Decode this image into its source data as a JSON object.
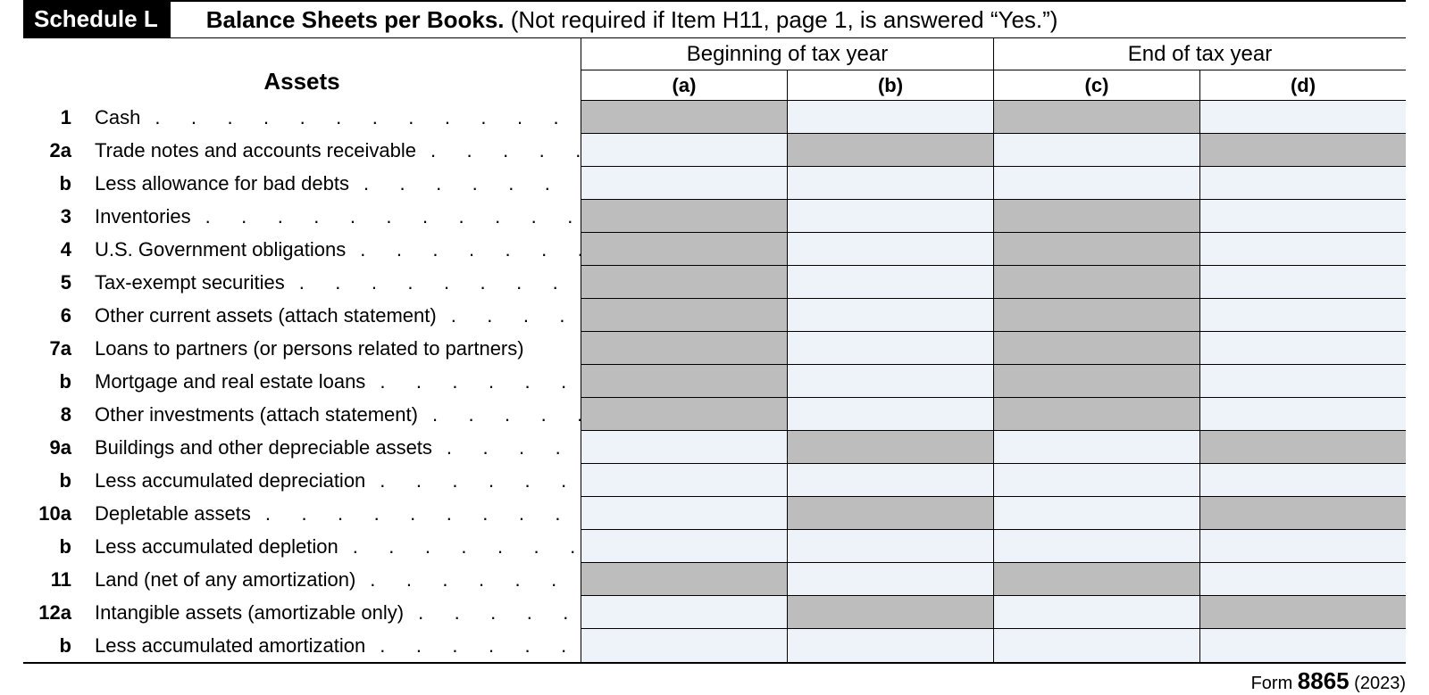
{
  "schedule": {
    "badge": "Schedule L",
    "title_bold": "Balance Sheets per Books.",
    "title_rest": " (Not required if Item H11, page 1, is answered “Yes.”)"
  },
  "headers": {
    "assets": "Assets",
    "period_begin": "Beginning of tax year",
    "period_end": "End of tax year",
    "col_a": "(a)",
    "col_b": "(b)",
    "col_c": "(c)",
    "col_d": "(d)"
  },
  "rows": [
    {
      "num": "1",
      "label": "Cash",
      "shaded": [
        "a",
        "c"
      ]
    },
    {
      "num": "2a",
      "label": "Trade notes and accounts receivable",
      "shaded": [
        "b",
        "d"
      ]
    },
    {
      "num": "b",
      "label": "Less allowance for bad debts",
      "shaded": []
    },
    {
      "num": "3",
      "label": "Inventories",
      "shaded": [
        "a",
        "c"
      ]
    },
    {
      "num": "4",
      "label": "U.S. Government obligations",
      "shaded": [
        "a",
        "c"
      ]
    },
    {
      "num": "5",
      "label": "Tax-exempt securities",
      "shaded": [
        "a",
        "c"
      ]
    },
    {
      "num": "6",
      "label": "Other current assets (attach statement)",
      "shaded": [
        "a",
        "c"
      ]
    },
    {
      "num": "7a",
      "label": "Loans to partners (or persons related to partners)",
      "shaded": [
        "a",
        "c"
      ],
      "no_dots": true
    },
    {
      "num": "b",
      "label": "Mortgage and real estate loans",
      "shaded": [
        "a",
        "c"
      ]
    },
    {
      "num": "8",
      "label": "Other investments (attach statement)",
      "shaded": [
        "a",
        "c"
      ]
    },
    {
      "num": "9a",
      "label": "Buildings and other depreciable assets",
      "shaded": [
        "b",
        "d"
      ]
    },
    {
      "num": "b",
      "label": "Less accumulated depreciation",
      "shaded": []
    },
    {
      "num": "10a",
      "label": "Depletable assets",
      "shaded": [
        "b",
        "d"
      ]
    },
    {
      "num": "b",
      "label": "Less accumulated depletion",
      "shaded": []
    },
    {
      "num": "11",
      "label": "Land (net of any amortization)",
      "shaded": [
        "a",
        "c"
      ]
    },
    {
      "num": "12a",
      "label": "Intangible assets (amortizable only)",
      "shaded": [
        "b",
        "d"
      ]
    },
    {
      "num": "b",
      "label": "Less accumulated amortization",
      "shaded": []
    }
  ],
  "footer": {
    "prefix": "Form ",
    "form_num": "8865",
    "suffix": " (2023)"
  }
}
